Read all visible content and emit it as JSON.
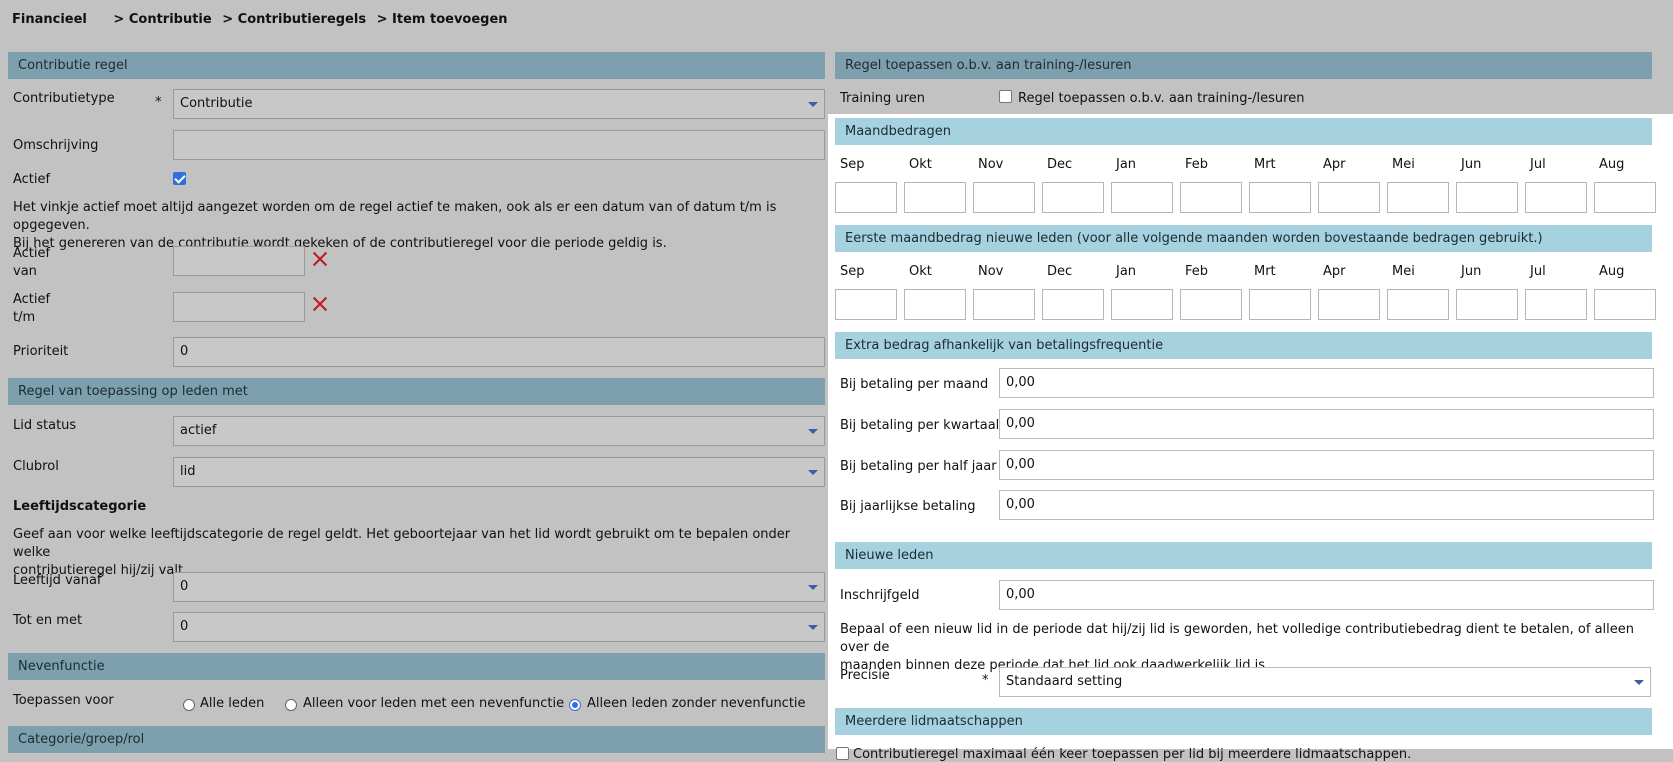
{
  "breadcrumb": [
    "Financieel",
    "Contributie",
    "Contributieregels",
    "Item toevoegen"
  ],
  "breadcrumb_sep": ">",
  "left": {
    "section_rule": "Contributie regel",
    "contributietype_label": "Contributietype",
    "contributietype_value": "Contributie",
    "required_mark": "*",
    "omschrijving_label": "Omschrijving",
    "omschrijving_value": "",
    "actief_label": "Actief",
    "actief_checked": true,
    "info_line1": "Het vinkje actief moet altijd aangezet worden om de regel actief te maken, ook als er een datum van of datum t/m is opgegeven.",
    "info_line2": "Bij het genereren van de contributie wordt gekeken of de contributieregel voor die periode geldig is.",
    "actief_van_label_1": "Actief",
    "actief_van_label_2": "van",
    "actief_tm_label_1": "Actief",
    "actief_tm_label_2": "t/m",
    "prioriteit_label": "Prioriteit",
    "prioriteit_value": "0",
    "section_apply": "Regel van toepassing op leden met",
    "lid_status_label": "Lid status",
    "lid_status_value": "actief",
    "clubrol_label": "Clubrol",
    "clubrol_value": "lid",
    "leeftijd_heading": "Leeftijdscategorie",
    "leeftijd_info_1": "Geef aan voor welke leeftijdscategorie de regel geldt. Het geboortejaar van het lid wordt gebruikt om te bepalen onder welke",
    "leeftijd_info_2": "contributieregel hij/zij valt.",
    "leeftijd_vanaf_label": "Leeftijd vanaf",
    "leeftijd_vanaf_value": "0",
    "tot_en_met_label": "Tot en met",
    "tot_en_met_value": "0",
    "section_nevenfunctie": "Nevenfunctie",
    "toepassen_label": "Toepassen voor",
    "radio_options": [
      "Alle leden",
      "Alleen voor leden met een nevenfunctie",
      "Alleen leden zonder nevenfunctie"
    ],
    "radio_selected": 2,
    "section_categorie": "Categorie/groep/rol"
  },
  "right": {
    "section_training": "Regel toepassen o.b.v. aan training-/lesuren",
    "training_uren_label": "Training uren",
    "training_checkbox_label": "Regel toepassen o.b.v. aan training-/lesuren",
    "training_checked": false,
    "section_maand": "Maandbedragen",
    "months": [
      "Sep",
      "Okt",
      "Nov",
      "Dec",
      "Jan",
      "Feb",
      "Mrt",
      "Apr",
      "Mei",
      "Jun",
      "Jul",
      "Aug"
    ],
    "section_eerste": "Eerste maandbedrag nieuwe leden (voor alle volgende maanden worden bovestaande bedragen gebruikt.)",
    "section_extra": "Extra bedrag afhankelijk van betalingsfrequentie",
    "per_maand_label": "Bij betaling per maand",
    "per_maand_value": "0,00",
    "per_kwartaal_label": "Bij betaling per kwartaal",
    "per_kwartaal_value": "0,00",
    "per_halfjaar_label": "Bij betaling per half jaar",
    "per_halfjaar_value": "0,00",
    "jaarlijks_label": "Bij jaarlijkse betaling",
    "jaarlijks_value": "0,00",
    "section_nieuwe": "Nieuwe leden",
    "inschrijfgeld_label": "Inschrijfgeld",
    "inschrijfgeld_value": "0,00",
    "nieuwe_info_1": "Bepaal of een nieuw lid in de periode dat hij/zij lid is geworden, het volledige contributiebedrag dient te betalen, of alleen over de",
    "nieuwe_info_2": "maanden binnen deze periode dat het lid ook daadwerkelijk lid is.",
    "precisie_label": "Precisie",
    "precisie_value": "Standaard setting",
    "section_meerdere": "Meerdere lidmaatschappen",
    "meerdere_checkbox_label": "Contributieregel maximaal één keer toepassen per lid bij meerdere lidmaatschappen.",
    "meerdere_checked": false
  },
  "colors": {
    "header": "#7e9fad",
    "header_light": "#a6d1de",
    "background": "#c2c2c2",
    "accent": "#2f6fe0",
    "clear_icon": "#c0161b"
  }
}
